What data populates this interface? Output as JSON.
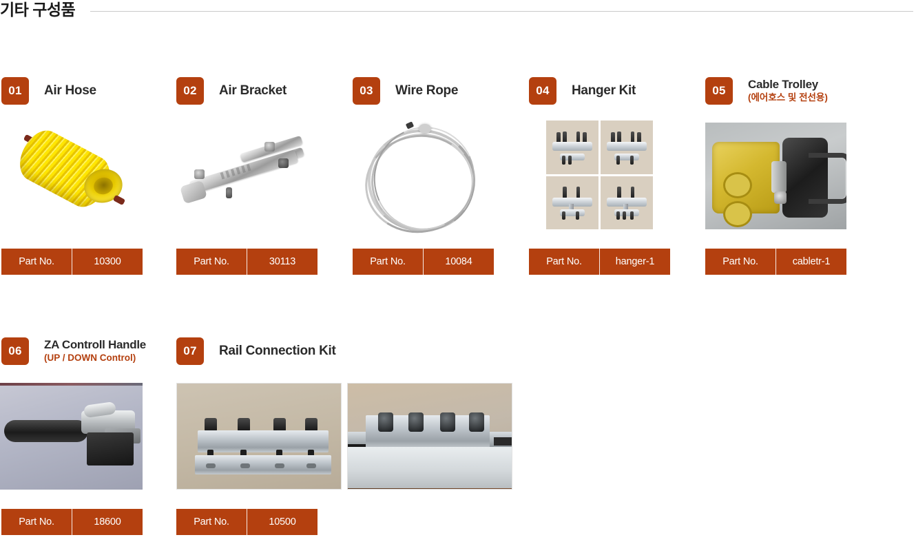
{
  "header": {
    "title": "기타 구성품"
  },
  "labels": {
    "part_no": "Part No."
  },
  "colors": {
    "accent": "#b4400f",
    "title_text": "#2b2b2b",
    "rule": "#c9c9c9"
  },
  "items": [
    {
      "number": "01",
      "title": "Air Hose",
      "subtitle": "",
      "part_no_label": "Part No.",
      "part_no_value": "10300",
      "image_name": "air-hose-photo"
    },
    {
      "number": "02",
      "title": "Air Bracket",
      "subtitle": "",
      "part_no_label": "Part No.",
      "part_no_value": "30113",
      "image_name": "air-bracket-photo"
    },
    {
      "number": "03",
      "title": "Wire Rope",
      "subtitle": "",
      "part_no_label": "Part No.",
      "part_no_value": "10084",
      "image_name": "wire-rope-photo"
    },
    {
      "number": "04",
      "title": "Hanger Kit",
      "subtitle": "",
      "part_no_label": "Part No.",
      "part_no_value": "hanger-1",
      "image_name": "hanger-kit-photo"
    },
    {
      "number": "05",
      "title": "Cable Trolley",
      "subtitle": "(에어호스 및 전선용)",
      "part_no_label": "Part No.",
      "part_no_value": "cabletr-1",
      "image_name": "cable-trolley-photo"
    },
    {
      "number": "06",
      "title": "ZA Controll Handle",
      "subtitle": "(UP / DOWN Control)",
      "part_no_label": "Part No.",
      "part_no_value": "18600",
      "image_name": "za-control-handle-photo"
    },
    {
      "number": "07",
      "title": "Rail Connection Kit",
      "subtitle": "",
      "part_no_label": "Part No.",
      "part_no_value": "10500",
      "image_name": "rail-connection-kit-photo"
    }
  ]
}
